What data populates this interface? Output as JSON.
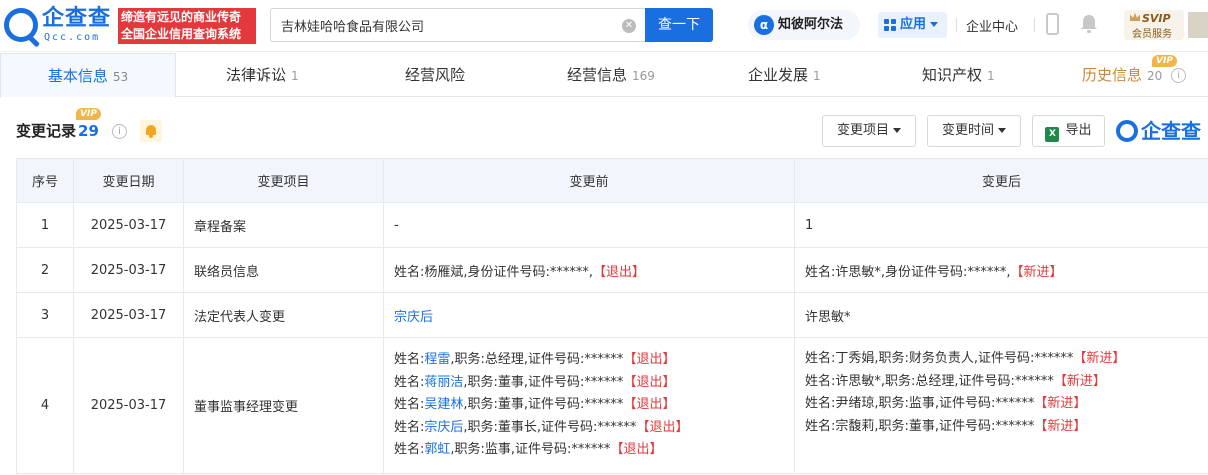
{
  "header": {
    "logo_text": "企查查",
    "logo_domain": "Qcc.com",
    "slogan_line1": "缔造有远见的商业传奇",
    "slogan_line2": "全国企业信用查询系统",
    "search_value": "吉林娃哈哈食品有限公司",
    "search_button": "查一下",
    "alpha_label": "知彼阿尔法",
    "apps_label": "应用",
    "enterprise_center": "企业中心",
    "svip_title": "SVIP",
    "svip_sub": "会员服务"
  },
  "tabs": [
    {
      "label": "基本信息",
      "count": "53"
    },
    {
      "label": "法律诉讼",
      "count": "1"
    },
    {
      "label": "经营风险",
      "count": ""
    },
    {
      "label": "经营信息",
      "count": "169"
    },
    {
      "label": "企业发展",
      "count": "1"
    },
    {
      "label": "知识产权",
      "count": "1"
    },
    {
      "label": "历史信息",
      "count": "20"
    }
  ],
  "vip_badge": "VIP",
  "section": {
    "title": "变更记录",
    "count": "29",
    "filter_item": "变更项目",
    "filter_time": "变更时间",
    "export": "导出",
    "brand": "企查查"
  },
  "table": {
    "headers": [
      "序号",
      "变更日期",
      "变更项目",
      "变更前",
      "变更后"
    ],
    "rows": [
      {
        "no": "1",
        "date": "2025-03-17",
        "item": "章程备案",
        "before": "-",
        "after": "1"
      },
      {
        "no": "2",
        "date": "2025-03-17",
        "item": "联络员信息",
        "before_text": "姓名:杨雁斌,身份证件号码:******,",
        "before_tag": "【退出】",
        "after_text": "姓名:许思敏*,身份证件号码:******,",
        "after_tag": "【新进】"
      },
      {
        "no": "3",
        "date": "2025-03-17",
        "item": "法定代表人变更",
        "before_link": "宗庆后",
        "after": "许思敏*"
      },
      {
        "no": "4",
        "date": "2025-03-17",
        "item": "董事监事经理变更",
        "before_lines": [
          {
            "pre": "姓名:",
            "name": "程雷",
            "post": ",职务:总经理,证件号码:******",
            "tag": "【退出】"
          },
          {
            "pre": "姓名:",
            "name": "蒋丽洁",
            "post": ",职务:董事,证件号码:******",
            "tag": "【退出】"
          },
          {
            "pre": "姓名:",
            "name": "吴建林",
            "post": ",职务:董事,证件号码:******",
            "tag": "【退出】"
          },
          {
            "pre": "姓名:",
            "name": "宗庆后",
            "post": ",职务:董事长,证件号码:******",
            "tag": "【退出】"
          },
          {
            "pre": "姓名:",
            "name": "郭虹",
            "post": ",职务:监事,证件号码:******",
            "tag": "【退出】"
          }
        ],
        "after_lines": [
          {
            "text": "姓名:丁秀娟,职务:财务负责人,证件号码:******",
            "tag": "【新进】"
          },
          {
            "text": "姓名:许思敏*,职务:总经理,证件号码:******",
            "tag": "【新进】"
          },
          {
            "text": "姓名:尹绪琼,职务:监事,证件号码:******",
            "tag": "【新进】"
          },
          {
            "text": "姓名:宗馥莉,职务:董事,证件号码:******",
            "tag": "【新进】"
          }
        ]
      }
    ]
  },
  "colors": {
    "brand_blue": "#1a6fe0",
    "red": "#e4393c",
    "history": "#c48a3a",
    "vip": "#f1b54a"
  },
  "icons": [
    "logo-icon",
    "clear-icon",
    "alpha-icon",
    "apps-icon",
    "phone-icon",
    "bell-icon",
    "svip-crown-icon",
    "info-icon",
    "excel-icon"
  ]
}
